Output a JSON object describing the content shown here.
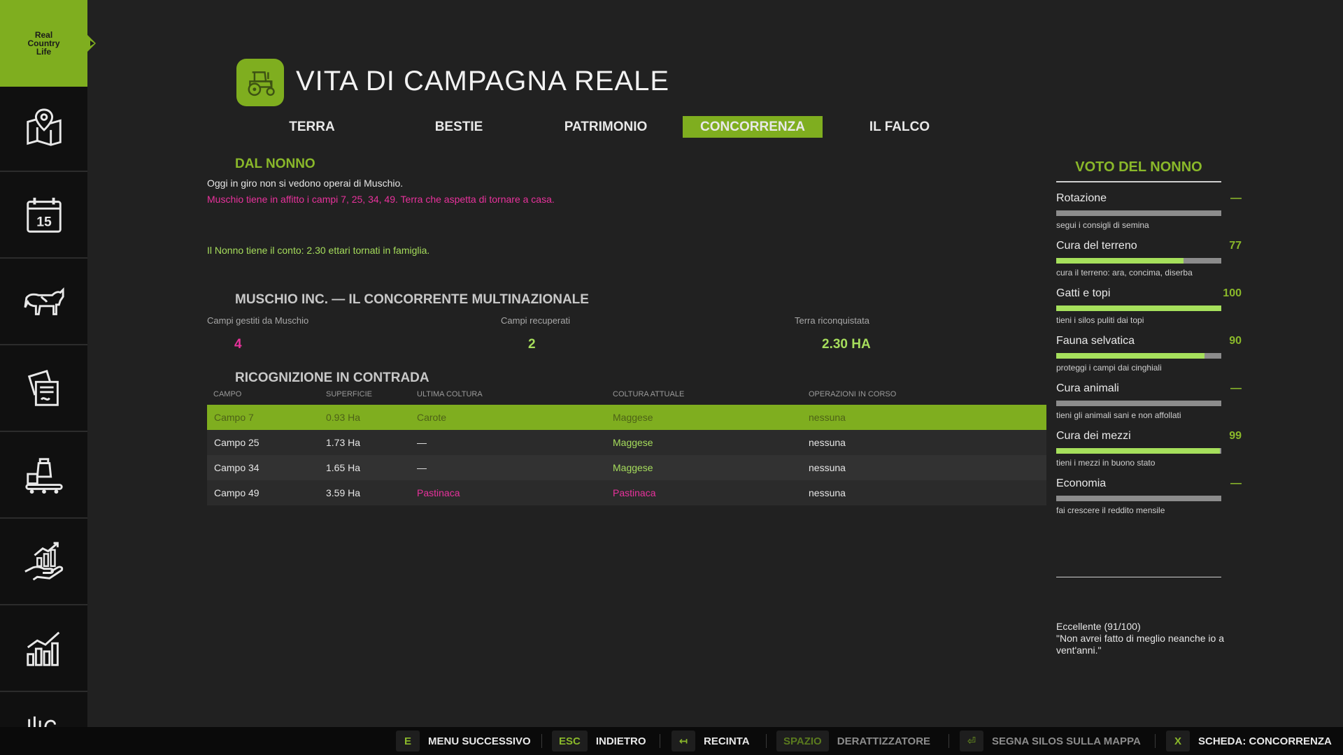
{
  "sidebar": {
    "logo_text": "Real Country Life",
    "items": [
      {
        "icon": "map-pin-icon"
      },
      {
        "icon": "calendar-icon",
        "badge": "15"
      },
      {
        "icon": "cow-icon"
      },
      {
        "icon": "documents-icon"
      },
      {
        "icon": "production-icon"
      },
      {
        "icon": "finance-hand-icon"
      },
      {
        "icon": "bar-chart-icon"
      },
      {
        "icon": "more-icon"
      }
    ]
  },
  "header": {
    "icon": "tractor-icon",
    "title": "VITA DI CAMPAGNA REALE"
  },
  "tabs": [
    {
      "label": "TERRA",
      "active": false
    },
    {
      "label": "BESTIE",
      "active": false
    },
    {
      "label": "PATRIMONIO",
      "active": false
    },
    {
      "label": "CONCORRENZA",
      "active": true
    },
    {
      "label": "IL FALCO",
      "active": false
    }
  ],
  "nonno": {
    "title": "DAL NONNO",
    "line1": "Oggi in giro non si vedono operai di Muschio.",
    "line2": "Muschio tiene in affitto i campi 7, 25, 34, 49. Terra che aspetta di tornare a casa.",
    "line3": "Il Nonno tiene il conto: 2.30 ettari tornati in famiglia."
  },
  "muschio": {
    "title": "MUSCHIO INC. — IL CONCORRENTE MULTINAZIONALE",
    "stats": [
      {
        "label": "Campi gestiti da Muschio",
        "value": "4"
      },
      {
        "label": "Campi recuperati",
        "value": "2"
      },
      {
        "label": "Terra riconquistata",
        "value": "2.30 HA"
      }
    ]
  },
  "ricognizione": {
    "title": "RICOGNIZIONE IN CONTRADA",
    "columns": [
      "CAMPO",
      "SUPERFICIE",
      "ULTIMA COLTURA",
      "COLTURA ATTUALE",
      "OPERAZIONI IN CORSO"
    ],
    "rows": [
      {
        "campo": "Campo 7",
        "superficie": "0.93 Ha",
        "ultima": "Carote",
        "attuale": "Maggese",
        "operazioni": "nessuna"
      },
      {
        "campo": "Campo 25",
        "superficie": "1.73 Ha",
        "ultima": "—",
        "attuale": "Maggese",
        "operazioni": "nessuna"
      },
      {
        "campo": "Campo 34",
        "superficie": "1.65 Ha",
        "ultima": "—",
        "attuale": "Maggese",
        "operazioni": "nessuna"
      },
      {
        "campo": "Campo 49",
        "superficie": "3.59 Ha",
        "ultima": "Pastinaca",
        "attuale": "Pastinaca",
        "operazioni": "nessuna"
      }
    ]
  },
  "voto": {
    "title": "VOTO DEL NONNO",
    "items": [
      {
        "label": "Rotazione",
        "value": "—",
        "level": 0,
        "hint": "segui i consigli di semina"
      },
      {
        "label": "Cura del terreno",
        "value": "77",
        "level": 0.77,
        "hint": "cura il terreno: ara, concima, diserba"
      },
      {
        "label": "Gatti e topi",
        "value": "100",
        "level": 1.0,
        "hint": "tieni i silos puliti dai topi"
      },
      {
        "label": "Fauna selvatica",
        "value": "90",
        "level": 0.9,
        "hint": "proteggi i campi dai cinghiali"
      },
      {
        "label": "Cura animali",
        "value": "—",
        "level": 0,
        "hint": "tieni gli animali sani e non affollati"
      },
      {
        "label": "Cura dei mezzi",
        "value": "99",
        "level": 0.99,
        "hint": "tieni i mezzi in buono stato"
      },
      {
        "label": "Economia",
        "value": "—",
        "level": 0,
        "hint": "fai crescere il reddito mensile"
      }
    ],
    "verdict_line1": "Eccellente (91/100)",
    "verdict_line2": "\"Non avrei fatto di meglio neanche io a vent'anni.\""
  },
  "bottom_hints": [
    {
      "key": "E",
      "label": "MENU SUCCESSIVO",
      "dim": false
    },
    {
      "key": "ESC",
      "label": "INDIETRO",
      "dim": false
    },
    {
      "key": "↤",
      "label": "RECINTA",
      "dim": false
    },
    {
      "key": "SPAZIO",
      "label": "DERATTIZZATORE",
      "dim": true
    },
    {
      "key": "⏎",
      "label": "SEGNA SILOS SULLA MAPPA",
      "dim": true
    },
    {
      "key": "X",
      "label": "SCHEDA: CONCORRENZA",
      "dim": false
    }
  ],
  "colors": {
    "accent": "#7fae1f",
    "pink": "#e8329c",
    "light_green": "#a6dd5c"
  }
}
